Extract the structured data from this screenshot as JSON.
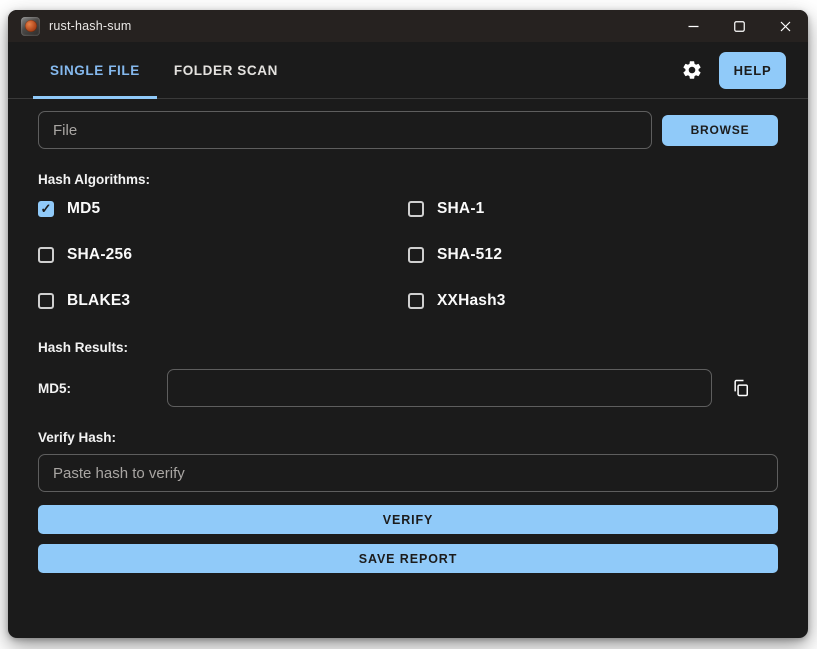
{
  "window": {
    "title": "rust-hash-sum",
    "controls": {
      "minimize_icon": "minimize-icon",
      "maximize_icon": "maximize-icon",
      "close_icon": "close-icon"
    }
  },
  "colors": {
    "accent": "#90caf9",
    "window_bg": "#1b1b1b",
    "titlebar_bg": "#262220",
    "active_tab_text": "#85b9ee",
    "button_text": "#1c1c1c"
  },
  "icons": {
    "app": "rust-hash-sum-icon",
    "settings": "gear-icon",
    "copy": "copy-icon",
    "check": "✓"
  },
  "tabs": [
    {
      "label": "SINGLE FILE",
      "active": true
    },
    {
      "label": "FOLDER SCAN",
      "active": false
    }
  ],
  "header": {
    "help_label": "HELP"
  },
  "file_row": {
    "placeholder": "File",
    "value": "",
    "browse_label": "BROWSE"
  },
  "algorithms": {
    "label": "Hash Algorithms:",
    "items": [
      {
        "label": "MD5",
        "checked": true
      },
      {
        "label": "SHA-1",
        "checked": false
      },
      {
        "label": "SHA-256",
        "checked": false
      },
      {
        "label": "SHA-512",
        "checked": false
      },
      {
        "label": "BLAKE3",
        "checked": false
      },
      {
        "label": "XXHash3",
        "checked": false
      }
    ]
  },
  "results": {
    "label": "Hash Results:",
    "rows": [
      {
        "label": "MD5:",
        "value": ""
      }
    ]
  },
  "verify": {
    "label": "Verify Hash:",
    "placeholder": "Paste hash to verify",
    "value": "",
    "verify_label": "VERIFY",
    "save_label": "SAVE REPORT"
  }
}
